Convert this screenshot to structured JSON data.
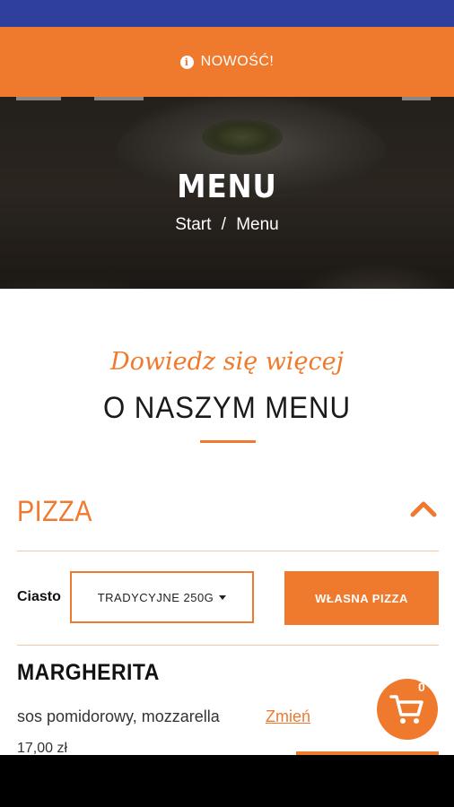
{
  "notice": {
    "icon": "info-icon",
    "label": "NOWOŚĆ!"
  },
  "hero": {
    "title": "MENU",
    "breadcrumb": {
      "home": "Start",
      "separator": "/",
      "current": "Menu"
    }
  },
  "intro": {
    "script": "Dowiedz się więcej",
    "title": "O NASZYM MENU"
  },
  "section": {
    "title": "PIZZA",
    "toggle_icon": "chevron-up-icon"
  },
  "dough": {
    "label": "Ciasto",
    "selected": "TRADYCYJNE 250G"
  },
  "own_pizza_label": "WŁASNA PIZZA",
  "item": {
    "name": "MARGHERITA",
    "description": "sos pomidorowy, mozzarella",
    "change_label": "Zmień",
    "price": "17,00 zł"
  },
  "cart": {
    "icon": "cart-icon",
    "count": "0"
  },
  "colors": {
    "accent": "#ef7a2d",
    "status_bar": "#2e3f9c"
  }
}
